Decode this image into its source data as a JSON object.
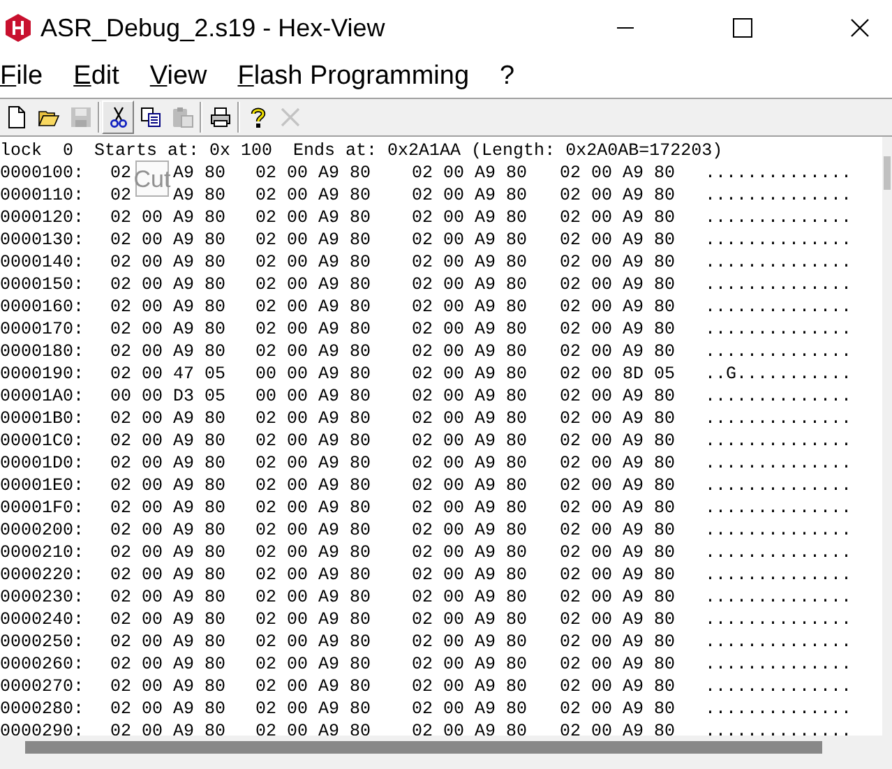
{
  "window": {
    "title": "ASR_Debug_2.s19 - Hex-View"
  },
  "menu": [
    {
      "label": "File"
    },
    {
      "label": "Edit"
    },
    {
      "label": "View"
    },
    {
      "label": "Flash Programming"
    },
    {
      "label": "?"
    }
  ],
  "toolbar": [
    {
      "kind": "new",
      "disabled": false,
      "pressed": false
    },
    {
      "kind": "open",
      "disabled": false,
      "pressed": false
    },
    {
      "kind": "save",
      "disabled": true,
      "pressed": false
    },
    {
      "kind": "sep"
    },
    {
      "kind": "cut",
      "disabled": false,
      "pressed": true
    },
    {
      "kind": "copy",
      "disabled": false,
      "pressed": false
    },
    {
      "kind": "paste",
      "disabled": true,
      "pressed": false
    },
    {
      "kind": "sep"
    },
    {
      "kind": "print",
      "disabled": false,
      "pressed": false
    },
    {
      "kind": "sep"
    },
    {
      "kind": "help",
      "disabled": false,
      "pressed": false
    },
    {
      "kind": "close",
      "disabled": true,
      "pressed": false
    }
  ],
  "tooltip": {
    "text": "Cut"
  },
  "dump": {
    "header": "lock  0  Starts at: 0x 100  Ends at: 0x2A1AA (Length: 0x2A0AB=172203)",
    "rows": [
      {
        "address": "0000100:",
        "groups": [
          [
            "02",
            "A9 80"
          ],
          "02 00 A9 80",
          "02 00 A9 80",
          "02 00 A9 80"
        ],
        "ascii": ".............."
      },
      {
        "address": "0000110:",
        "groups": [
          [
            "02",
            "A9 80"
          ],
          "02 00 A9 80",
          "02 00 A9 80",
          "02 00 A9 80"
        ],
        "ascii": ".............."
      },
      {
        "address": "0000120:",
        "groups": [
          "02 00 A9 80",
          "02 00 A9 80",
          "02 00 A9 80",
          "02 00 A9 80"
        ],
        "ascii": ".............."
      },
      {
        "address": "0000130:",
        "groups": [
          "02 00 A9 80",
          "02 00 A9 80",
          "02 00 A9 80",
          "02 00 A9 80"
        ],
        "ascii": ".............."
      },
      {
        "address": "0000140:",
        "groups": [
          "02 00 A9 80",
          "02 00 A9 80",
          "02 00 A9 80",
          "02 00 A9 80"
        ],
        "ascii": ".............."
      },
      {
        "address": "0000150:",
        "groups": [
          "02 00 A9 80",
          "02 00 A9 80",
          "02 00 A9 80",
          "02 00 A9 80"
        ],
        "ascii": ".............."
      },
      {
        "address": "0000160:",
        "groups": [
          "02 00 A9 80",
          "02 00 A9 80",
          "02 00 A9 80",
          "02 00 A9 80"
        ],
        "ascii": ".............."
      },
      {
        "address": "0000170:",
        "groups": [
          "02 00 A9 80",
          "02 00 A9 80",
          "02 00 A9 80",
          "02 00 A9 80"
        ],
        "ascii": ".............."
      },
      {
        "address": "0000180:",
        "groups": [
          "02 00 A9 80",
          "02 00 A9 80",
          "02 00 A9 80",
          "02 00 A9 80"
        ],
        "ascii": ".............."
      },
      {
        "address": "0000190:",
        "groups": [
          "02 00 47 05",
          "00 00 A9 80",
          "02 00 A9 80",
          "02 00 8D 05"
        ],
        "ascii": "..G..........."
      },
      {
        "address": "00001A0:",
        "groups": [
          "00 00 D3 05",
          "00 00 A9 80",
          "02 00 A9 80",
          "02 00 A9 80"
        ],
        "ascii": ".............."
      },
      {
        "address": "00001B0:",
        "groups": [
          "02 00 A9 80",
          "02 00 A9 80",
          "02 00 A9 80",
          "02 00 A9 80"
        ],
        "ascii": ".............."
      },
      {
        "address": "00001C0:",
        "groups": [
          "02 00 A9 80",
          "02 00 A9 80",
          "02 00 A9 80",
          "02 00 A9 80"
        ],
        "ascii": ".............."
      },
      {
        "address": "00001D0:",
        "groups": [
          "02 00 A9 80",
          "02 00 A9 80",
          "02 00 A9 80",
          "02 00 A9 80"
        ],
        "ascii": ".............."
      },
      {
        "address": "00001E0:",
        "groups": [
          "02 00 A9 80",
          "02 00 A9 80",
          "02 00 A9 80",
          "02 00 A9 80"
        ],
        "ascii": ".............."
      },
      {
        "address": "00001F0:",
        "groups": [
          "02 00 A9 80",
          "02 00 A9 80",
          "02 00 A9 80",
          "02 00 A9 80"
        ],
        "ascii": ".............."
      },
      {
        "address": "0000200:",
        "groups": [
          "02 00 A9 80",
          "02 00 A9 80",
          "02 00 A9 80",
          "02 00 A9 80"
        ],
        "ascii": ".............."
      },
      {
        "address": "0000210:",
        "groups": [
          "02 00 A9 80",
          "02 00 A9 80",
          "02 00 A9 80",
          "02 00 A9 80"
        ],
        "ascii": ".............."
      },
      {
        "address": "0000220:",
        "groups": [
          "02 00 A9 80",
          "02 00 A9 80",
          "02 00 A9 80",
          "02 00 A9 80"
        ],
        "ascii": ".............."
      },
      {
        "address": "0000230:",
        "groups": [
          "02 00 A9 80",
          "02 00 A9 80",
          "02 00 A9 80",
          "02 00 A9 80"
        ],
        "ascii": ".............."
      },
      {
        "address": "0000240:",
        "groups": [
          "02 00 A9 80",
          "02 00 A9 80",
          "02 00 A9 80",
          "02 00 A9 80"
        ],
        "ascii": ".............."
      },
      {
        "address": "0000250:",
        "groups": [
          "02 00 A9 80",
          "02 00 A9 80",
          "02 00 A9 80",
          "02 00 A9 80"
        ],
        "ascii": ".............."
      },
      {
        "address": "0000260:",
        "groups": [
          "02 00 A9 80",
          "02 00 A9 80",
          "02 00 A9 80",
          "02 00 A9 80"
        ],
        "ascii": ".............."
      },
      {
        "address": "0000270:",
        "groups": [
          "02 00 A9 80",
          "02 00 A9 80",
          "02 00 A9 80",
          "02 00 A9 80"
        ],
        "ascii": ".............."
      },
      {
        "address": "0000280:",
        "groups": [
          "02 00 A9 80",
          "02 00 A9 80",
          "02 00 A9 80",
          "02 00 A9 80"
        ],
        "ascii": ".............."
      },
      {
        "address": "0000290:",
        "groups": [
          "02 00 A9 80",
          "02 00 A9 80",
          "02 00 A9 80",
          "02 00 A9 80"
        ],
        "ascii": ".............."
      }
    ]
  }
}
